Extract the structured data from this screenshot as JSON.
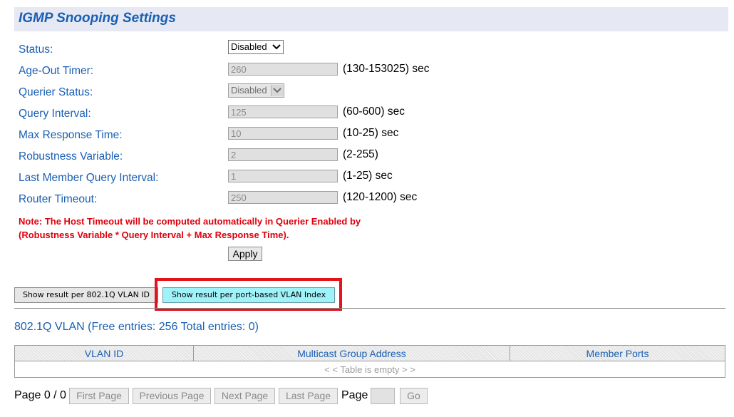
{
  "header": {
    "title": "IGMP Snooping Settings"
  },
  "settings": {
    "status": {
      "label": "Status:",
      "value": "Disabled"
    },
    "age_out": {
      "label": "Age-Out Timer:",
      "value": "260",
      "unit": "(130-153025) sec"
    },
    "querier_status": {
      "label": "Querier Status:",
      "value": "Disabled"
    },
    "query_interval": {
      "label": "Query Interval:",
      "value": "125",
      "unit": "(60-600) sec"
    },
    "max_response": {
      "label": "Max Response Time:",
      "value": "10",
      "unit": "(10-25) sec"
    },
    "robustness": {
      "label": "Robustness Variable:",
      "value": "2",
      "unit": "(2-255)"
    },
    "last_member": {
      "label": "Last Member Query Interval:",
      "value": "1",
      "unit": "(1-25) sec"
    },
    "router_timeout": {
      "label": "Router Timeout:",
      "value": "250",
      "unit": "(120-1200) sec"
    }
  },
  "note": {
    "line1": "Note: The Host Timeout will be computed automatically in Querier Enabled by",
    "line2": "(Robustness Variable * Query Interval + Max Response Time)."
  },
  "apply_label": "Apply",
  "view_tabs": {
    "vlan_id": "Show result per 802.1Q VLAN ID",
    "port_based": "Show result per port-based VLAN Index"
  },
  "vlan_section": {
    "title": "802.1Q VLAN (Free entries: 256 Total entries: 0)",
    "columns": [
      "VLAN ID",
      "Multicast Group Address",
      "Member Ports"
    ],
    "empty_message": "< < Table is empty > >"
  },
  "pager": {
    "page_info": "Page 0 / 0",
    "first": "First Page",
    "previous": "Previous Page",
    "next": "Next Page",
    "last": "Last Page",
    "page_label": "Page",
    "page_input": "",
    "go": "Go"
  },
  "colors": {
    "label_blue": "#1a5fb4",
    "note_red": "#e0000c",
    "highlight_border": "#e3131b",
    "active_tab": "#9ff2f7"
  },
  "icons": {
    "dropdown": "chevron-down-icon"
  }
}
